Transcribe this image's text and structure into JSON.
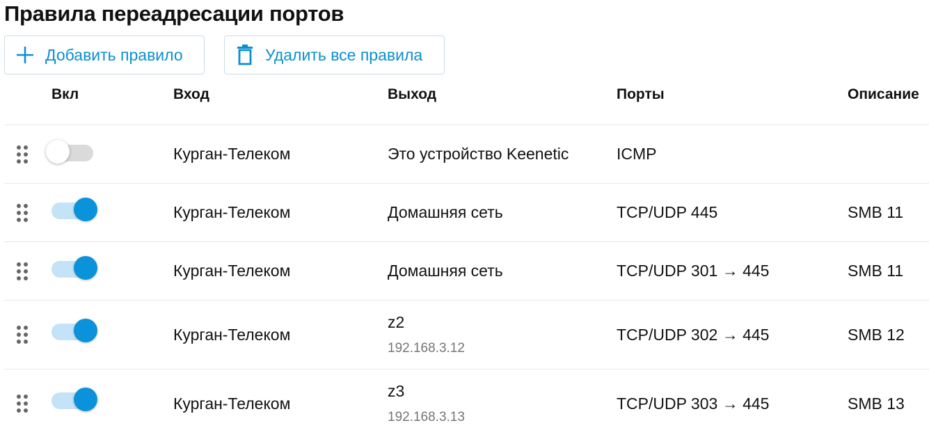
{
  "page": {
    "title": "Правила переадресации портов"
  },
  "toolbar": {
    "add_label": "Добавить правило",
    "delete_all_label": "Удалить все правила"
  },
  "table": {
    "headers": {
      "enabled": "Вкл",
      "input": "Вход",
      "output": "Выход",
      "ports": "Порты",
      "description": "Описание"
    },
    "rows": [
      {
        "enabled": false,
        "input": "Курган-Телеком",
        "output": "Это устройство Keenetic",
        "output_ip": "",
        "ports": "ICMP",
        "description": ""
      },
      {
        "enabled": true,
        "input": "Курган-Телеком",
        "output": "Домашняя сеть",
        "output_ip": "",
        "ports": "TCP/UDP 445",
        "description": "SMB 11"
      },
      {
        "enabled": true,
        "input": "Курган-Телеком",
        "output": "Домашняя сеть",
        "output_ip": "",
        "ports": "TCP/UDP 301 → 445",
        "description": "SMB 11"
      },
      {
        "enabled": true,
        "input": "Курган-Телеком",
        "output": "z2",
        "output_ip": "192.168.3.12",
        "ports": "TCP/UDP 302 → 445",
        "description": "SMB 12"
      },
      {
        "enabled": true,
        "input": "Курган-Телеком",
        "output": "z3",
        "output_ip": "192.168.3.13",
        "ports": "TCP/UDP 303 → 445",
        "description": "SMB 13"
      }
    ]
  },
  "colors": {
    "accent": "#0a92db",
    "toggle_track_on": "#c5e3f7",
    "toggle_track_off": "#dadada"
  }
}
